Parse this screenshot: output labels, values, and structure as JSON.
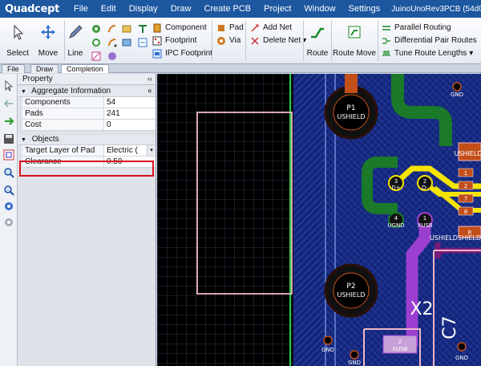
{
  "app": {
    "logo": "Quadcept",
    "menu": [
      "File",
      "Edit",
      "Display",
      "Draw",
      "Create PCB",
      "Project",
      "Window",
      "Settings"
    ],
    "document_title": "JuinoUnoRev3PCB (54d013caac"
  },
  "ribbon": {
    "select": "Select",
    "move": "Move",
    "line": "Line",
    "component": "Component",
    "footprint": "Footprint",
    "ipc_footprint": "IPC Footprint",
    "pad": "Pad",
    "via": "Via",
    "add_net": "Add Net",
    "delete_net": "Delete Net",
    "delete_net_arrow": "▾",
    "route": "Route",
    "route_move": "Route Move",
    "parallel_routing": "Parallel Routing",
    "differential_pair_routes": "Differential Pair Routes",
    "tune_route_lengths": "Tune Route Lengths",
    "tune_route_arrow": "▾"
  },
  "tabs": [
    "File",
    "Draw",
    "Completion"
  ],
  "panel": {
    "title": "Property",
    "pin": "‹‹",
    "aggregate": {
      "header": "Aggregate Information",
      "rows": [
        {
          "name": "Components",
          "value": "54"
        },
        {
          "name": "Pads",
          "value": "241"
        },
        {
          "name": "Cost",
          "value": "0"
        }
      ]
    },
    "objects": {
      "header": "Objects",
      "rows": [
        {
          "name": "Target Layer of Pad",
          "value": "Electric (",
          "dropdown": "▾"
        },
        {
          "name": "Clearance",
          "value": "0.50"
        }
      ]
    }
  },
  "canvas": {
    "labels": {
      "p1": "P1",
      "ushield_1": "USHIELD",
      "p2": "P2",
      "ushield_2": "USHIELD",
      "gnd_top": "GND",
      "pin3": "3",
      "pin3_net": "D+",
      "pin2": "2",
      "pin2_net": "D-",
      "pin4": "4",
      "pin4_net": "UGND",
      "pin1": "1",
      "pin1_net": "XUSB",
      "ushieldshield_1": "USHIELD",
      "ushieldshield_2": "USHIELDSHIELD",
      "x2": "X2",
      "c7": "C7",
      "pad2": "2",
      "pad2_net": "XUSB",
      "gnd_b1": "GND",
      "gnd_b2": "GND",
      "gnd_b3": "GND",
      "r_small_1": "1",
      "r_small_2": "2",
      "r_small_3": "7",
      "r_small_4": "8",
      "r_small_5": "R"
    }
  },
  "colors": {
    "menubar": "#1c57a0",
    "grid": "#35405a",
    "copper_blue": "#1d3fa6",
    "green_trace": "#1a7a2a",
    "yellow_trace": "#f4e400",
    "purple_trace": "#9b3fd0",
    "orange_pad": "#c24e1a",
    "silk_pink": "#f0b7c8",
    "highlight": "#d8121a"
  }
}
